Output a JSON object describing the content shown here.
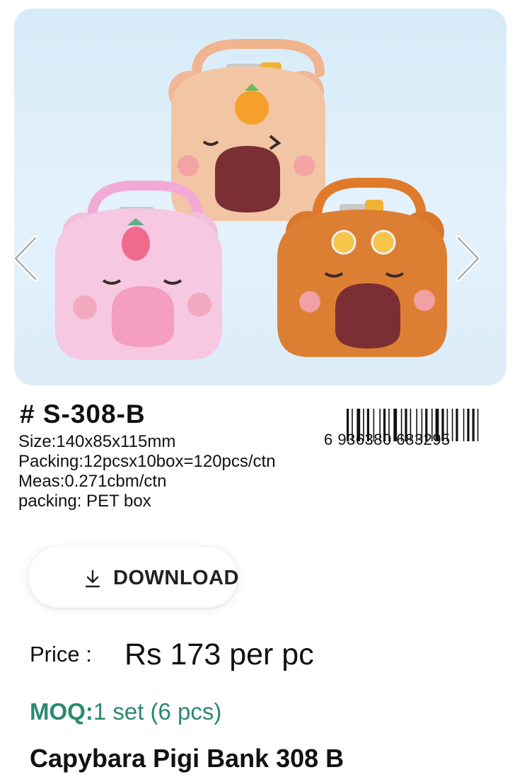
{
  "product": {
    "sku": "# S-308-B",
    "specs": [
      "Size:140x85x115mm",
      "Packing:12pcsx10box=120pcs/ctn",
      "Meas:0.271cbm/ctn",
      "packing: PET box"
    ],
    "barcode_digits": "6  936380  683295",
    "title": "Capybara Pigi Bank 308 B"
  },
  "actions": {
    "download_label": "DOWNLOAD"
  },
  "pricing": {
    "price_label": "Price :",
    "price_value": "Rs 173 per pc",
    "moq_label": "MOQ:",
    "moq_value": "1 set (6 pcs)"
  },
  "icons": {
    "prev": "chevron-left-icon",
    "next": "chevron-right-icon",
    "download": "download-icon"
  },
  "colors": {
    "moq_accent": "#2b8a6e",
    "carousel_bg": "#dcecf8"
  }
}
